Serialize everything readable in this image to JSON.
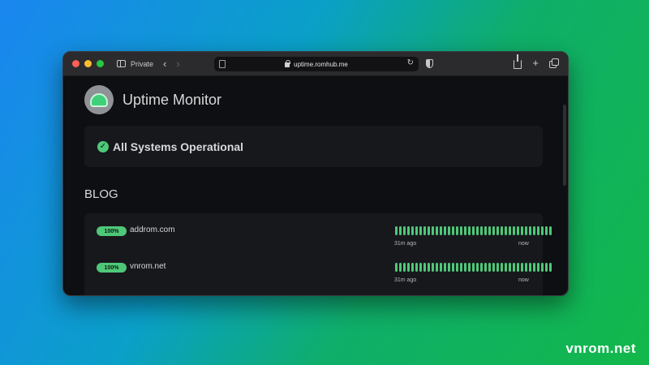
{
  "browser": {
    "private_label": "Private",
    "url": "uptime.romhub.me",
    "back_glyph": "‹",
    "forward_glyph": "›",
    "reload_glyph": "↻",
    "new_tab_glyph": "+"
  },
  "header": {
    "title": "Uptime Monitor"
  },
  "status": {
    "text": "All Systems Operational",
    "check_glyph": "✓",
    "color": "#4ec878"
  },
  "section": {
    "title": "BLOG"
  },
  "monitors": [
    {
      "badge": "100%",
      "name": "addrom.com",
      "time_start": "31m ago",
      "time_end": "now"
    },
    {
      "badge": "100%",
      "name": "vnrom.net",
      "time_start": "31m ago",
      "time_end": "now"
    }
  ],
  "heartbeat": {
    "count": 39,
    "color": "#4ec878"
  },
  "watermark": "vnrom.net"
}
